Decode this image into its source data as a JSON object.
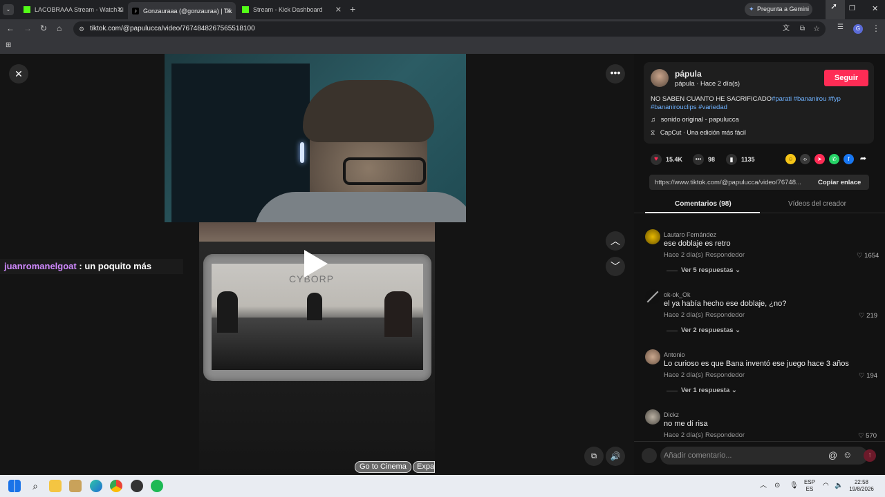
{
  "browser": {
    "tabs": [
      {
        "title": "LACOBRAAA Stream - Watch Li"
      },
      {
        "title": "Gonzauraaa (@gonzauraa) | Tik"
      },
      {
        "title": "Stream - Kick Dashboard"
      }
    ],
    "new_tab": "+",
    "gemini_label": "Pregunta a Gemini",
    "url": "tiktok.com/@papulucca/video/7674848267565518100",
    "profile_initial": "G"
  },
  "overlay": {
    "chat_user": "juanromanelgoat",
    "chat_message": ": un poquito más",
    "go_to_cinema": "Go to Cinema",
    "expand": "Expa"
  },
  "video_panel": {
    "sign_text": "CYBORP"
  },
  "post": {
    "author": "pápula",
    "author_sub": "pápula · Hace 2 día(s)",
    "follow_label": "Seguir",
    "caption_text": "NO SABEN CUANTO HE SACRIFICADO",
    "hashtags_line1": "#parati #bananirou #fyp",
    "hashtags_line2": "#bananirouclips #variedad",
    "sound": "sonido original - papulucca",
    "capcut": "CapCut · Una edición más fácil",
    "likes": "15.4K",
    "comments": "98",
    "saves": "1135",
    "link": "https://www.tiktok.com/@papulucca/video/76748...",
    "copy_label": "Copiar enlace",
    "tab_comments": "Comentarios (98)",
    "tab_creator": "Vídeos del creador"
  },
  "comments": [
    {
      "user": "Lautaro Fernández",
      "text": "ese doblaje es retro",
      "time": "Hace 2 día(s)",
      "reply": "Respondedor",
      "likes": "1654",
      "more": "Ver 5 respuestas"
    },
    {
      "user": "ok-ok_Ok",
      "text": "el ya había hecho ese doblaje, ¿no?",
      "time": "Hace 2 día(s)",
      "reply": "Respondedor",
      "likes": "219",
      "more": "Ver 2 respuestas"
    },
    {
      "user": "Antonio",
      "text": "Lo curioso es que Bana inventó ese juego hace 3 años",
      "time": "Hace 2 día(s)",
      "reply": "Respondedor",
      "likes": "194",
      "more": "Ver 1 respuesta"
    },
    {
      "user": "Dickz",
      "text": "no me dí risa",
      "time": "Hace 2 día(s)",
      "reply": "Respondedor",
      "likes": "570",
      "more": ""
    }
  ],
  "comment_input": {
    "placeholder": "Añadir comentario...",
    "at": "@"
  },
  "taskbar": {
    "lang_top": "ESP",
    "lang_bottom": "ES",
    "time": "22:58",
    "date": "19/8/2026"
  }
}
